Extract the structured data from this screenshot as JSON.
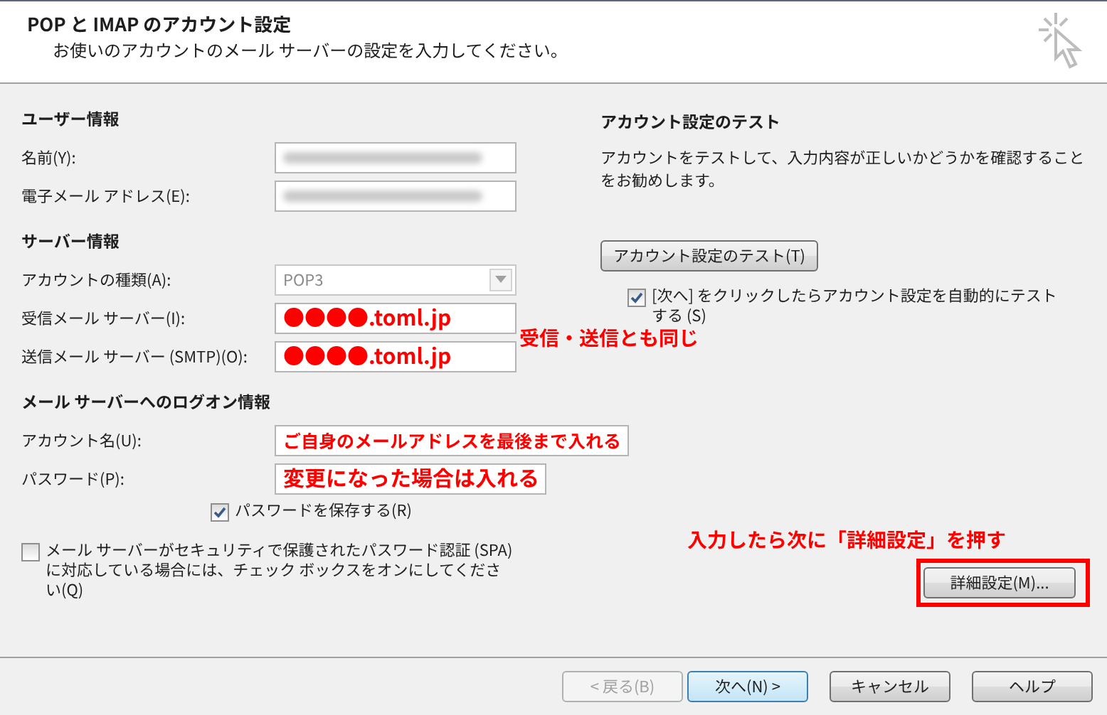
{
  "header": {
    "title": "POP と IMAP のアカウント設定",
    "subtitle": "お使いのアカウントのメール サーバーの設定を入力してください。"
  },
  "sections": [
    {
      "heading": "ユーザー情報",
      "rows": [
        {
          "label": "名前(Y):",
          "kind": "blurred"
        },
        {
          "label": "電子メール アドレス(E):",
          "kind": "blurred"
        }
      ]
    },
    {
      "heading": "サーバー情報",
      "rows": [
        {
          "label": "アカウントの種類(A):",
          "kind": "select",
          "value": "POP3",
          "disabled": true
        },
        {
          "label": "受信メール サーバー(I):",
          "kind": "note",
          "value": "●●●●.toml.jp"
        },
        {
          "label": "送信メール サーバー (SMTP)(O):",
          "kind": "note",
          "value": "●●●●.toml.jp"
        }
      ]
    },
    {
      "heading": "メール サーバーへのログオン情報",
      "rows": [
        {
          "label": "アカウント名(U):",
          "kind": "note",
          "value": "ご自身のメールアドレスを最後まで入れる"
        },
        {
          "label": "パスワード(P):",
          "kind": "note",
          "value": "変更になった場合は入れる"
        }
      ]
    }
  ],
  "save_password": {
    "label": "パスワードを保存する(R)",
    "checked": true
  },
  "spa": {
    "label": "メール サーバーがセキュリティで保護されたパスワード認証 (SPA) に対応している場合には、チェック ボックスをオンにしてください(Q)",
    "checked": false
  },
  "test": {
    "heading": "アカウント設定のテスト",
    "description": "アカウントをテストして、入力内容が正しいかどうかを確認することをお勧めします。",
    "button": "アカウント設定のテスト(T)",
    "auto_test": {
      "label": "[次へ] をクリックしたらアカウント設定を自動的にテストする (S)",
      "checked": true
    }
  },
  "annotations": [
    {
      "text": "受信・送信とも同じ"
    },
    {
      "text": "入力したら次に「詳細設定」を押す"
    }
  ],
  "advanced_button": {
    "label": "詳細設定(M)...",
    "highlighted": true
  },
  "footer_buttons": [
    {
      "label": "< 戻る(B)",
      "disabled": true,
      "default": false
    },
    {
      "label": "次へ(N) >",
      "disabled": false,
      "default": true
    },
    {
      "label": "キャンセル",
      "disabled": false,
      "default": false
    },
    {
      "label": "ヘルプ",
      "disabled": false,
      "default": false
    }
  ]
}
